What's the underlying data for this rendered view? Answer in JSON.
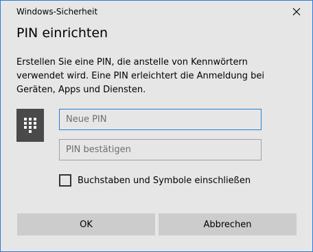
{
  "window": {
    "title": "Windows-Sicherheit",
    "close_icon": "close-icon"
  },
  "dialog": {
    "heading": "PIN einrichten",
    "description": "Erstellen Sie eine PIN, die anstelle von Kennwörtern verwendet wird. Eine PIN erleichtert die Anmeldung bei Geräten, Apps und Diensten.",
    "pin_icon": "keypad-icon"
  },
  "form": {
    "new_pin": {
      "value": "",
      "placeholder": "Neue PIN"
    },
    "confirm_pin": {
      "value": "",
      "placeholder": "PIN bestätigen"
    },
    "include_symbols": {
      "label": "Buchstaben und Symbole einschließen",
      "checked": false
    }
  },
  "buttons": {
    "ok_label": "OK",
    "cancel_label": "Abbrechen"
  },
  "colors": {
    "accent": "#2b7cd3",
    "background": "#e6e6e6",
    "button": "#cccccc",
    "icon_tile": "#4a4a4a"
  }
}
